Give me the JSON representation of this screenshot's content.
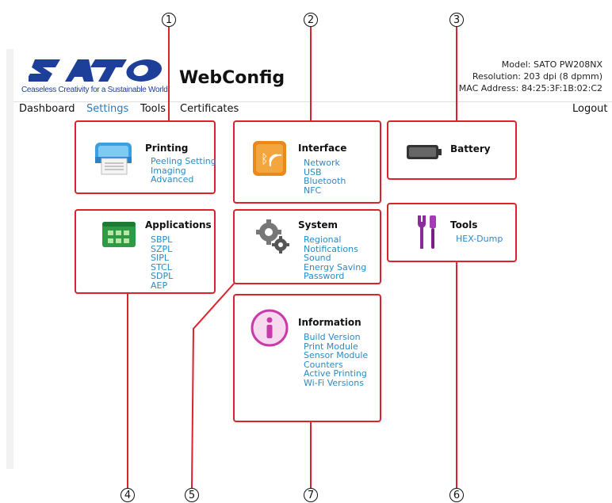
{
  "header": {
    "tagline": "Ceaseless Creativity for a Sustainable World",
    "app_title": "WebConfig",
    "model": "Model: SATO PW208NX",
    "resolution": "Resolution: 203 dpi (8 dpmm)",
    "mac": "MAC Address: 84:25:3F:1B:02:C2"
  },
  "nav": {
    "dashboard": "Dashboard",
    "settings": "Settings",
    "tools": "Tools",
    "certificates": "Certificates",
    "logout": "Logout"
  },
  "cards": {
    "printing": {
      "title": "Printing",
      "links": [
        "Peeling Setting",
        "Imaging",
        "Advanced"
      ]
    },
    "interface": {
      "title": "Interface",
      "links": [
        "Network",
        "USB",
        "Bluetooth",
        "NFC"
      ]
    },
    "battery": {
      "title": "Battery"
    },
    "applications": {
      "title": "Applications",
      "links": [
        "SBPL",
        "SZPL",
        "SIPL",
        "STCL",
        "SDPL",
        "AEP"
      ]
    },
    "system": {
      "title": "System",
      "links": [
        "Regional",
        "Notifications",
        "Sound",
        "Energy Saving",
        "Password"
      ]
    },
    "tools": {
      "title": "Tools",
      "links": [
        "HEX-Dump"
      ]
    },
    "information": {
      "title": "Information",
      "links": [
        "Build Version",
        "Print Module",
        "Sensor Module",
        "Counters",
        "Active Printing",
        "Wi-Fi Versions"
      ]
    }
  },
  "callouts": [
    "1",
    "2",
    "3",
    "4",
    "5",
    "6",
    "7"
  ],
  "colors": {
    "annotation_red": "#d9232d",
    "link_blue": "#2a8ac4",
    "brand_blue": "#1e3f99"
  }
}
